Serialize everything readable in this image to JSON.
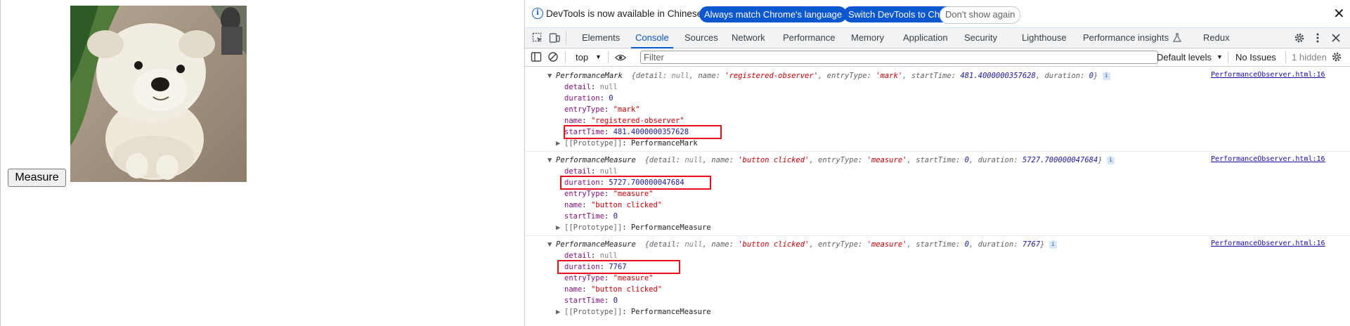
{
  "page": {
    "measure_button": "Measure",
    "image_subject": "white-puppy-photo"
  },
  "devtools": {
    "infobar": {
      "message": "DevTools is now available in Chinese!",
      "btn_match": "Always match Chrome's language",
      "btn_switch": "Switch DevTools to Chinese",
      "btn_dismiss": "Don't show again",
      "close": "✕"
    },
    "tabs": [
      "Elements",
      "Console",
      "Sources",
      "Network",
      "Performance",
      "Memory",
      "Application",
      "Security",
      "Lighthouse",
      "Performance insights",
      "Redux"
    ],
    "active_tab": "Console",
    "toolbar": {
      "context": "top",
      "filter_placeholder": "Filter",
      "levels": "Default levels",
      "issues": "No Issues",
      "hidden": "1 hidden"
    },
    "colors": {
      "accent": "#0b57d0",
      "highlight": "#e8111b"
    },
    "entries": [
      {
        "type": "PerformanceMark",
        "summary": {
          "p1": "{detail: ",
          "detail": "null",
          "p2": ", name: ",
          "name": "'registered-observer'",
          "p3": ", entryType: ",
          "entryType": "'mark'",
          "p4": ", startTime: ",
          "startTime": "481.4000000357628",
          "p5": ", duration: ",
          "duration": "0",
          "p6": "}"
        },
        "source": "PerformanceObserver.html:16",
        "props": [
          {
            "k": "detail",
            "v": "null",
            "kind": "null"
          },
          {
            "k": "duration",
            "v": "0",
            "kind": "num"
          },
          {
            "k": "entryType",
            "v": "\"mark\"",
            "kind": "str"
          },
          {
            "k": "name",
            "v": "\"registered-observer\"",
            "kind": "str"
          },
          {
            "k": "startTime",
            "v": "481.4000000357628",
            "kind": "num"
          }
        ],
        "proto_key": "[[Prototype]]",
        "proto_val": "PerformanceMark"
      },
      {
        "type": "PerformanceMeasure",
        "summary": {
          "p1": "{detail: ",
          "detail": "null",
          "p2": ", name: ",
          "name": "'button clicked'",
          "p3": ", entryType: ",
          "entryType": "'measure'",
          "p4": ", startTime: ",
          "startTime": "0",
          "p5": ", duration: ",
          "duration": "5727.700000047684",
          "p6": "}"
        },
        "source": "PerformanceObserver.html:16",
        "props": [
          {
            "k": "detail",
            "v": "null",
            "kind": "null"
          },
          {
            "k": "duration",
            "v": "5727.700000047684",
            "kind": "num"
          },
          {
            "k": "entryType",
            "v": "\"measure\"",
            "kind": "str"
          },
          {
            "k": "name",
            "v": "\"button clicked\"",
            "kind": "str"
          },
          {
            "k": "startTime",
            "v": "0",
            "kind": "num"
          }
        ],
        "proto_key": "[[Prototype]]",
        "proto_val": "PerformanceMeasure"
      },
      {
        "type": "PerformanceMeasure",
        "summary": {
          "p1": "{detail: ",
          "detail": "null",
          "p2": ", name: ",
          "name": "'button clicked'",
          "p3": ", entryType: ",
          "entryType": "'measure'",
          "p4": ", startTime: ",
          "startTime": "0",
          "p5": ", duration: ",
          "duration": "7767",
          "p6": "}"
        },
        "source": "PerformanceObserver.html:16",
        "props": [
          {
            "k": "detail",
            "v": "null",
            "kind": "null"
          },
          {
            "k": "duration",
            "v": "7767",
            "kind": "num"
          },
          {
            "k": "entryType",
            "v": "\"measure\"",
            "kind": "str"
          },
          {
            "k": "name",
            "v": "\"button clicked\"",
            "kind": "str"
          },
          {
            "k": "startTime",
            "v": "0",
            "kind": "num"
          }
        ],
        "proto_key": "[[Prototype]]",
        "proto_val": "PerformanceMeasure"
      }
    ]
  }
}
